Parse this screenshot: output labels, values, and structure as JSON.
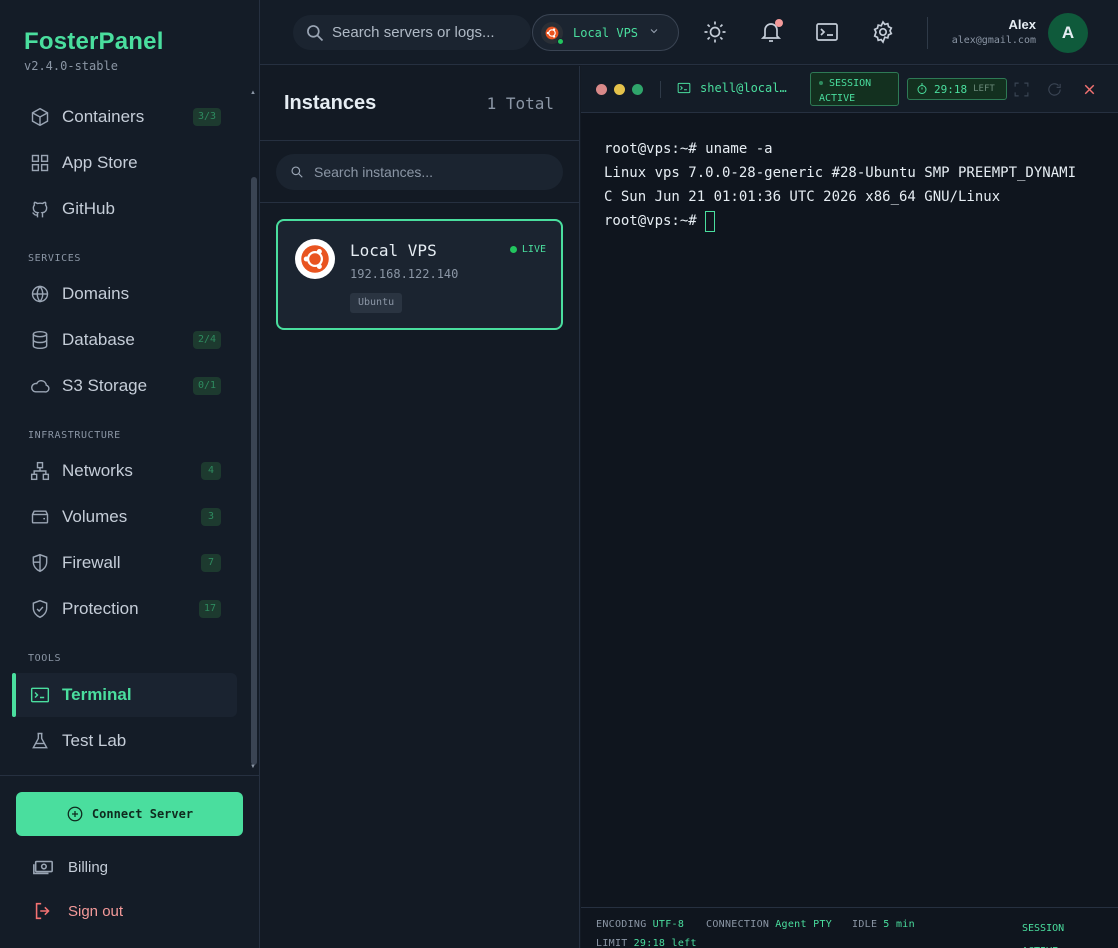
{
  "brand": {
    "title": "FosterPanel",
    "version": "v2.4.0-stable"
  },
  "sidebar": {
    "items": [
      {
        "label": "Containers",
        "badge": "3/3",
        "icon": "box-icon"
      },
      {
        "label": "App Store",
        "badge": "",
        "icon": "grid-icon"
      },
      {
        "label": "GitHub",
        "badge": "",
        "icon": "github-icon"
      },
      {
        "label": "Domains",
        "badge": "",
        "icon": "globe-icon"
      },
      {
        "label": "Database",
        "badge": "2/4",
        "icon": "database-icon"
      },
      {
        "label": "S3 Storage",
        "badge": "0/1",
        "icon": "cloud-icon"
      },
      {
        "label": "Networks",
        "badge": "4",
        "icon": "network-icon"
      },
      {
        "label": "Volumes",
        "badge": "3",
        "icon": "hard-drive-icon"
      },
      {
        "label": "Firewall",
        "badge": "7",
        "icon": "shield-icon"
      },
      {
        "label": "Protection",
        "badge": "17",
        "icon": "shield-check-icon"
      },
      {
        "label": "Terminal",
        "badge": "",
        "icon": "terminal-icon",
        "active": true
      },
      {
        "label": "Test Lab",
        "badge": "",
        "icon": "flask-icon"
      }
    ],
    "sections": {
      "services": "SERVICES",
      "infrastructure": "INFRASTRUCTURE",
      "tools": "TOOLS"
    },
    "connect_label": "Connect Server",
    "billing_label": "Billing",
    "signout_label": "Sign out"
  },
  "header": {
    "search_placeholder": "Search servers or logs...",
    "server_label": "Local VPS",
    "user_name": "Alex",
    "user_email": "alex@gmail.com",
    "avatar_initial": "A"
  },
  "instances": {
    "title": "Instances",
    "total": "1 Total",
    "search_placeholder": "Search instances...",
    "items": [
      {
        "name": "Local VPS",
        "ip": "192.168.122.140",
        "tag": "Ubuntu",
        "status": "LIVE"
      }
    ]
  },
  "terminal": {
    "shell_label": "shell@local…",
    "session_line1": "SESSION",
    "session_line2": "ACTIVE",
    "timer": "29:18",
    "timer_suffix": "LEFT",
    "lines": [
      "root@vps:~# uname -a",
      "Linux vps 7.0.0-28-generic #28-Ubuntu SMP PREEMPT_DYNAMI",
      "C Sun Jun 21 01:01:36 UTC 2026 x86_64 GNU/Linux",
      "root@vps:~#"
    ],
    "footer": {
      "encoding_label": "ENCODING",
      "encoding_value": "UTF-8",
      "connection_label": "CONNECTION",
      "connection_value": "Agent PTY",
      "idle_label": "IDLE",
      "idle_value": "5 min",
      "limit_label": "LIMIT",
      "limit_value": "29:18 left",
      "session_line1": "SESSION",
      "session_line2": "ACTIVE"
    }
  },
  "colors": {
    "accent": "#4ade9e",
    "danger": "#f47272",
    "background": "#131a24"
  }
}
